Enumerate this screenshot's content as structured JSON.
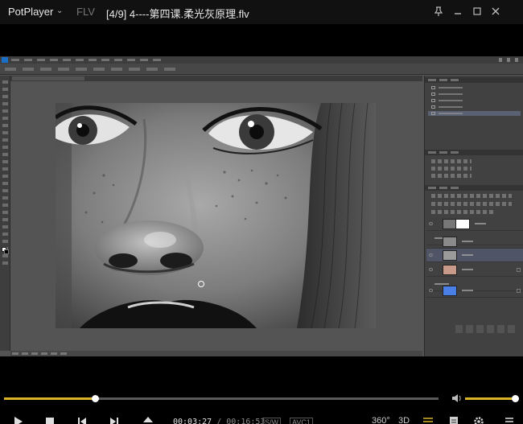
{
  "app": {
    "brand": "PotPlayer",
    "format": "FLV",
    "file_title": "[4/9] 4----第四课.柔光灰原理.flv"
  },
  "icons": {
    "brand_menu": "chevron-down-icon",
    "pin": "pin-icon",
    "minimize": "minimize-icon",
    "maximize": "maximize-icon",
    "close": "close-icon",
    "volume": "speaker-icon",
    "play": "play-icon",
    "stop": "stop-icon",
    "prev": "skip-previous-icon",
    "next": "skip-next-icon",
    "eject": "eject-icon",
    "settings": "gear-icon",
    "playlist": "menu-icon"
  },
  "playback": {
    "current_time": "00:03:27",
    "separator": "/",
    "total_time": "00:16:53",
    "progress": 0.21,
    "volume": 0.98
  },
  "badges": {
    "subtitle": "S/W",
    "codec": "AVC1"
  },
  "buttons": {
    "vr360": "360°",
    "mode3d": "3D"
  },
  "colors": {
    "accent": "#d9b526",
    "background": "#000000",
    "selected_layer": "#4f5566",
    "fill_layer": "#4a7fe8"
  }
}
